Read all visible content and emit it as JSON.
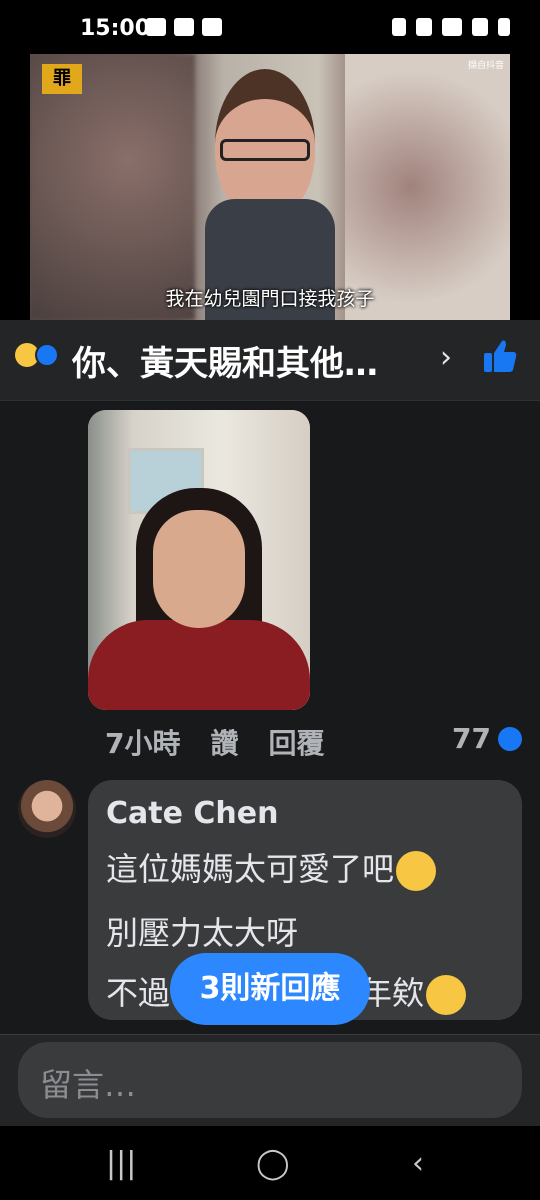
{
  "status_bar": {
    "time": "15:00"
  },
  "video": {
    "channel_logo": "罪",
    "watermark": "擷自抖音",
    "subtitle": "我在幼兒園門口接我孩子"
  },
  "reactions_header": {
    "names": "你、黃天賜和其他…"
  },
  "photo_comment": {
    "meta": {
      "time": "7小時",
      "like": "讚",
      "reply": "回覆",
      "count": "77"
    }
  },
  "comment": {
    "author": "Cate Chen",
    "line1": "這位媽媽太可愛了吧",
    "line2": "別壓力太大呀",
    "line3_start": "不過",
    "line3_end": "年欸"
  },
  "new_replies_button": "3則新回應",
  "composer": {
    "placeholder": "留言…"
  },
  "colors": {
    "accent": "#2d88ff",
    "like": "#1877f2",
    "bubble": "#3a3b3c",
    "background": "#18191a"
  }
}
